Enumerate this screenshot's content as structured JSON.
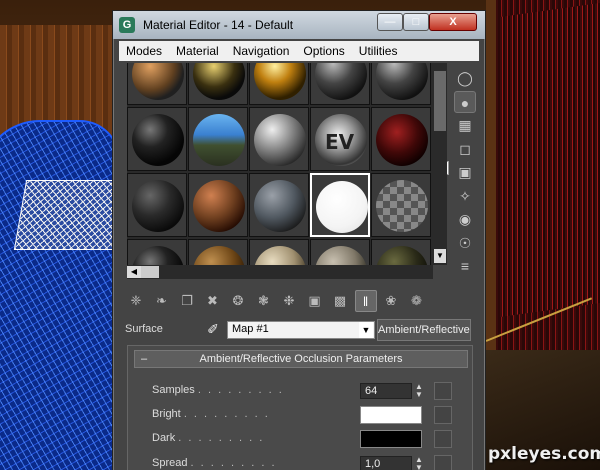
{
  "window": {
    "title": "Material Editor - 14 - Default",
    "app_icon": "G",
    "minimize_label": "—",
    "maximize_label": "□",
    "close_label": "X"
  },
  "menu": [
    "Modes",
    "Material",
    "Navigation",
    "Options",
    "Utilities"
  ],
  "slots": [
    {
      "style": "multicolor"
    },
    {
      "style": "dark-gold"
    },
    {
      "style": "gold"
    },
    {
      "style": "dark-gray"
    },
    {
      "style": "dark-gray"
    },
    {
      "style": "black"
    },
    {
      "style": "landscape"
    },
    {
      "style": "gray"
    },
    {
      "style": "ev-chrome"
    },
    {
      "style": "dark-red"
    },
    {
      "style": "dark-sparkle"
    },
    {
      "style": "brown"
    },
    {
      "style": "stone"
    },
    {
      "style": "white"
    },
    {
      "style": "checker"
    },
    {
      "style": "black"
    },
    {
      "style": "wood"
    },
    {
      "style": "beige"
    },
    {
      "style": "marble"
    },
    {
      "style": "dark-olive"
    }
  ],
  "side_tools": [
    "sample-sphere-icon",
    "backlight-icon",
    "checker-background-icon",
    "sample-uv-icon",
    "video-color-check-icon",
    "make-preview-icon",
    "material-options-icon",
    "select-by-material-icon",
    "material-map-navigator-icon"
  ],
  "side_tool_glyphs": [
    "◯",
    "●",
    "▦",
    "◻",
    "▣",
    "✧",
    "◉",
    "☉",
    "≡"
  ],
  "toolbar": {
    "tools": [
      "get-material-icon",
      "put-to-scene-icon",
      "assign-material-icon",
      "reset-icon",
      "copy-material-icon",
      "make-unique-icon",
      "put-to-library-icon",
      "material-id-icon",
      "show-map-icon",
      "show-end-result-icon",
      "go-to-parent-icon",
      "go-forward-icon"
    ],
    "glyphs": [
      "❈",
      "❧",
      "❐",
      "✖",
      "❂",
      "❃",
      "❉",
      "▣",
      "▩",
      "‖",
      "❀",
      "❁"
    ]
  },
  "surface": {
    "label": "Surface",
    "picker_icon": "✐",
    "map_name": "Map #1",
    "type_button": "Ambient/Reflective Occlusion"
  },
  "rollout": {
    "minus": "–",
    "title": "Ambient/Reflective Occlusion Parameters",
    "samples_label": "Samples",
    "samples_value": "64",
    "bright_label": "Bright",
    "dark_label": "Dark",
    "spread_label": "Spread",
    "spread_value": "1,0",
    "dots": ". . . . . . . . .",
    "bright_color": "#ffffff",
    "dark_color": "#000000"
  },
  "watermark": "pxleyes.com"
}
